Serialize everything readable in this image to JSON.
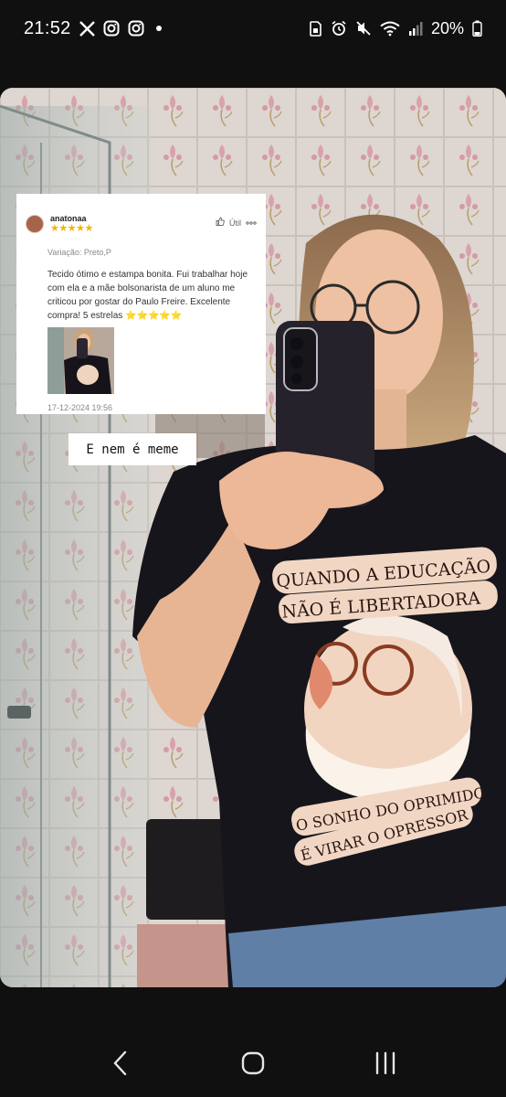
{
  "status_bar": {
    "time": "21:52",
    "battery": "20%",
    "left_icons": [
      "x-icon",
      "instagram-icon",
      "instagram-icon",
      "notification-dot-icon"
    ],
    "right_icons": [
      "sim-icon",
      "alarm-icon",
      "mute-icon",
      "wifi-icon",
      "signal-icon",
      "battery-icon"
    ]
  },
  "review": {
    "username": "anatonaa",
    "stars": "★★★★★",
    "rating": 5,
    "helpful_label": "Útil",
    "variation": "Variação: Preto,P",
    "text": "Tecido ótimo e estampa bonita. Fui trabalhar hoje com ela e a mãe bolsonarista de um aluno me criticou por gostar do Paulo Freire. Excelente compra! 5 estrelas",
    "emoji": "⭐⭐⭐⭐⭐",
    "date": "17-12-2024 19:56"
  },
  "caption": "E nem é meme",
  "shirt": {
    "top_line1": "QUANDO A EDUCAÇÃO",
    "top_line2": "NÃO É LIBERTADORA",
    "bottom_line1": "O SONHO DO OPRIMIDO",
    "bottom_line2": "É VIRAR O OPRESSOR"
  },
  "nav": {
    "back": "back-icon",
    "home": "home-icon",
    "recents": "recents-icon"
  },
  "colors": {
    "background": "#101010",
    "star": "#f5b400",
    "shirt": "#17151c",
    "shirt_print": "#f1d7c3"
  }
}
